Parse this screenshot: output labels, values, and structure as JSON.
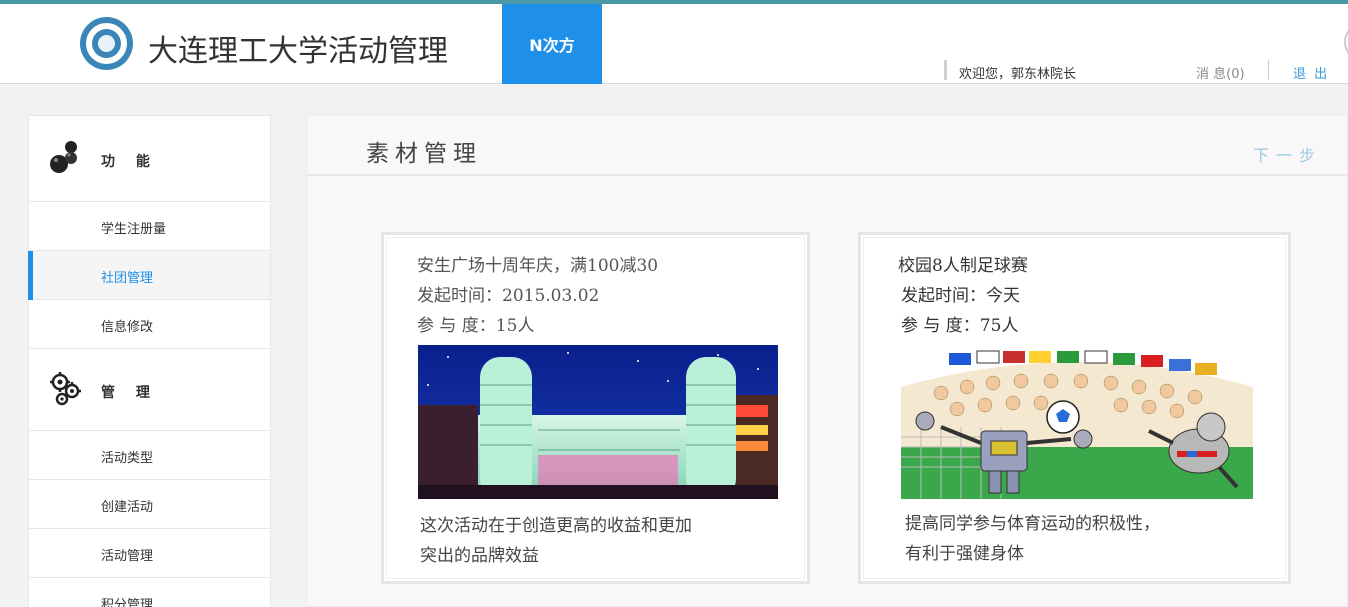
{
  "header": {
    "site_title": "大连理工大学活动管理",
    "brand_tab": "N次方",
    "welcome": "欢迎您，郭东林院长",
    "messages": "消 息(0)",
    "logout": "退 出"
  },
  "sidebar": {
    "sections": [
      {
        "label": "功 能",
        "icon": "bubbles-icon",
        "items": [
          "学生注册量",
          "社团管理",
          "信息修改"
        ]
      },
      {
        "label": "管 理",
        "icon": "gears-icon",
        "items": [
          "活动类型",
          "创建活动",
          "活动管理",
          "积分管理"
        ]
      }
    ],
    "active_item": "社团管理"
  },
  "main": {
    "title": "素材管理",
    "next_step": "下一步",
    "cards": [
      {
        "title": "安生广场十周年庆，满100减30",
        "start_time": "发起时间：2015.03.02",
        "participation": "参 与 度：15人",
        "image": "mall-night-photo",
        "description_line1": "这次活动在于创造更高的收益和更加",
        "description_line2": "突出的品牌效益"
      },
      {
        "title": "校园8人制足球赛",
        "start_time": "发起时间：今天",
        "participation": "参 与 度：75人",
        "image": "robot-soccer-cartoon",
        "description_line1": "提高同学参与体育运动的积极性，",
        "description_line2": "有利于强健身体"
      }
    ]
  },
  "colors": {
    "accent_blue": "#1e90ea",
    "top_line": "#4a9aa6",
    "link_blue": "#3a9ad9"
  }
}
